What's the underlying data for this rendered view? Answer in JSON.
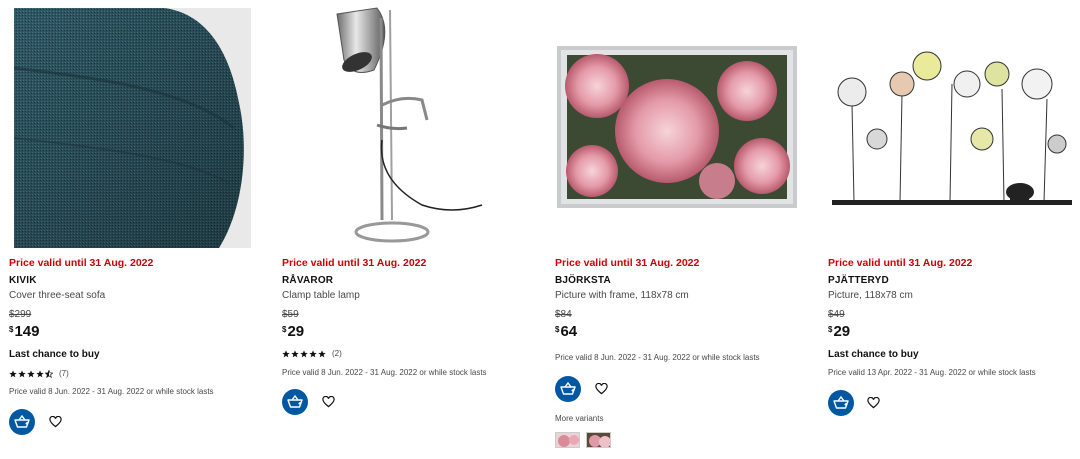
{
  "products": [
    {
      "price_valid_until": "Price valid until 31 Aug. 2022",
      "name": "KIVIK",
      "description": "Cover three-seat sofa",
      "old_price": "$299",
      "currency": "$",
      "price": "149",
      "badge": "Last chance to buy",
      "rating": 4.5,
      "rating_count": "(7)",
      "valid_note": "Price valid 8 Jun. 2022 - 31 Aug. 2022 or while stock lasts"
    },
    {
      "price_valid_until": "Price valid until 31 Aug. 2022",
      "name": "RÅVAROR",
      "description": "Clamp table lamp",
      "old_price": "$59",
      "currency": "$",
      "price": "29",
      "rating": 5,
      "rating_count": "(2)",
      "valid_note": "Price valid 8 Jun. 2022 - 31 Aug. 2022 or while stock lasts"
    },
    {
      "price_valid_until": "Price valid until 31 Aug. 2022",
      "name": "BJÖRKSTA",
      "description": "Picture with frame, 118x78 cm",
      "old_price": "$84",
      "currency": "$",
      "price": "64",
      "valid_note": "Price valid 8 Jun. 2022 - 31 Aug. 2022 or while stock lasts",
      "more_variants": "More variants"
    },
    {
      "price_valid_until": "Price valid until 31 Aug. 2022",
      "name": "PJÄTTERYD",
      "description": "Picture, 118x78 cm",
      "old_price": "$49",
      "currency": "$",
      "price": "29",
      "badge": "Last chance to buy",
      "valid_note": "Price valid 13 Apr. 2022 - 31 Aug. 2022 or while stock lasts"
    }
  ],
  "colors": {
    "sale_red": "#cc0008",
    "ikea_blue": "#0058a3",
    "text_dark": "#111111",
    "text_muted": "#484848"
  },
  "icons": {
    "cart": "add-to-cart-icon",
    "favourite": "heart-icon",
    "star": "star-icon"
  }
}
